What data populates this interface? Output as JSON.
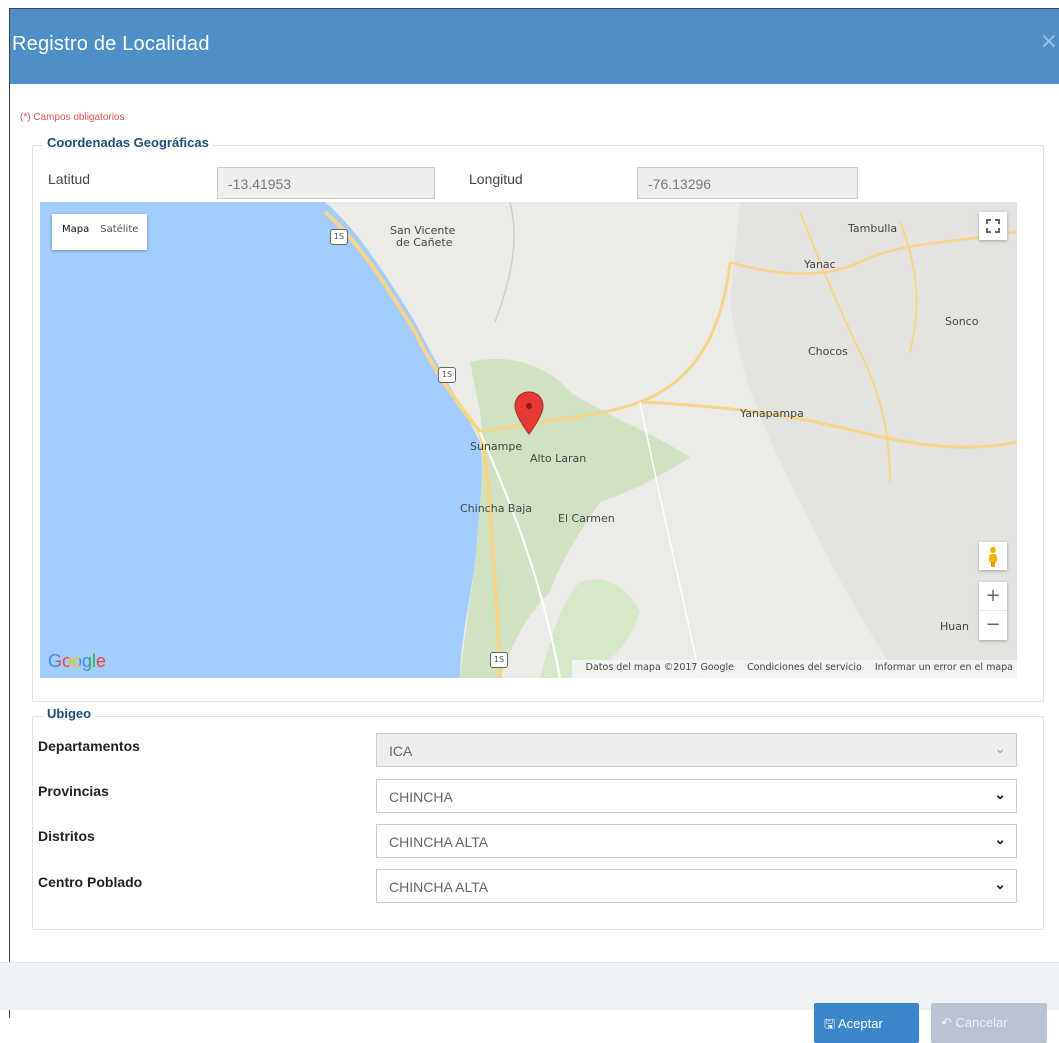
{
  "dialog": {
    "title": "Registro de Localidad",
    "close_glyph": "×"
  },
  "required_note": "(*) Campos obligatorios",
  "coords": {
    "legend": "Coordenadas Geográficas",
    "lat_label": "Latitud",
    "lat_value": "-13.41953",
    "lon_label": "Longitud",
    "lon_value": "-76.13296"
  },
  "map": {
    "type_buttons": [
      "Mapa",
      "Satélite"
    ],
    "places": [
      "San Vicente",
      "de Cañete",
      "Tambulla",
      "Yanac",
      "Sonco",
      "Chocos",
      "Yanapampa",
      "Sunampe",
      "Alto Laran",
      "Chincha Baja",
      "El Carmen",
      "Huan"
    ],
    "highway": "1S",
    "attribution": [
      "Datos del mapa ©2017 Google",
      "Condiciones del servicio",
      "Informar un error en el mapa"
    ],
    "logo": "Google",
    "zoom_in": "+",
    "zoom_out": "−",
    "colors": {
      "water": "#a3ccff",
      "land": "#ecebe8",
      "green": "#cfe3c3",
      "road": "#f6d488",
      "pin": "#e53935"
    }
  },
  "ubigeo": {
    "legend": "Ubigeo",
    "rows": [
      {
        "label": "Departamentos",
        "value": "ICA"
      },
      {
        "label": "Provincias",
        "value": "CHINCHA"
      },
      {
        "label": "Distritos",
        "value": "CHINCHA ALTA"
      },
      {
        "label": "Centro Poblado",
        "value": "CHINCHA ALTA"
      }
    ]
  },
  "footer": {
    "accept_label": "Aceptar",
    "cancel_label": "Cancelar"
  }
}
